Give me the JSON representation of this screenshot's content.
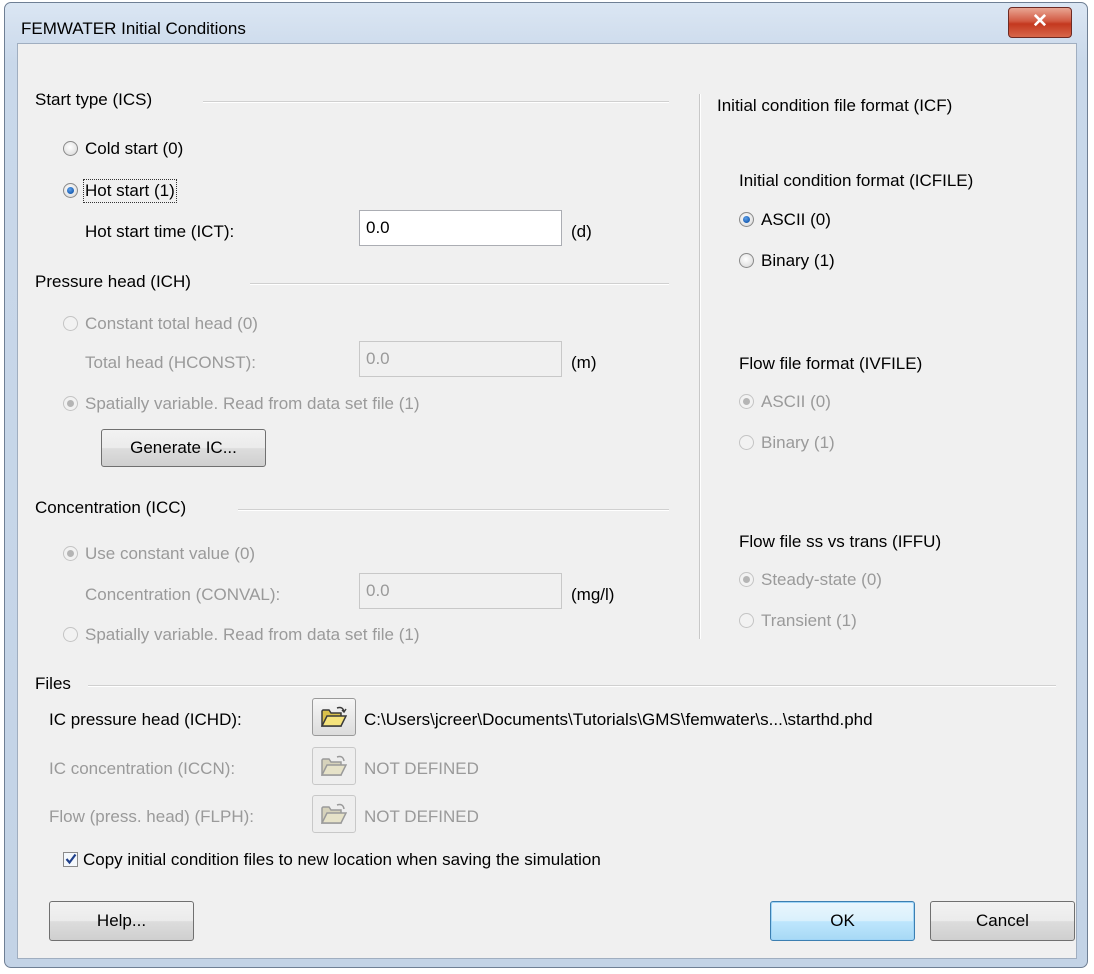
{
  "window": {
    "title": "FEMWATER Initial Conditions",
    "close_glyph": "✕"
  },
  "start_type": {
    "legend": "Start type (ICS)",
    "cold": "Cold start (0)",
    "hot": "Hot start (1)",
    "selected": "hot",
    "time_label": "Hot start time (ICT):",
    "time_value": "0.0",
    "time_unit": "(d)"
  },
  "pressure_head": {
    "legend": "Pressure head (ICH)",
    "constant": "Constant total head (0)",
    "total_label": "Total head (HCONST):",
    "total_value": "0.0",
    "total_unit": "(m)",
    "spatial": "Spatially variable. Read from data set file (1)",
    "selected": "spatial",
    "generate_button": "Generate IC..."
  },
  "concentration": {
    "legend": "Concentration (ICC)",
    "constant": "Use constant value (0)",
    "conc_label": "Concentration (CONVAL):",
    "conc_value": "0.0",
    "conc_unit": "(mg/l)",
    "spatial": "Spatially variable. Read from data set file (1)",
    "selected": "constant"
  },
  "icf": {
    "legend": "Initial condition file format (ICF)",
    "icfile": {
      "label": "Initial condition format (ICFILE)",
      "ascii": "ASCII (0)",
      "binary": "Binary (1)",
      "selected": "ascii"
    },
    "ivfile": {
      "label": "Flow file format (IVFILE)",
      "ascii": "ASCII (0)",
      "binary": "Binary (1)",
      "selected": "ascii"
    },
    "iffu": {
      "label": "Flow file ss vs trans (IFFU)",
      "steady": "Steady-state (0)",
      "transient": "Transient (1)",
      "selected": "steady"
    }
  },
  "files": {
    "legend": "Files",
    "ichd_label": "IC pressure head (ICHD):",
    "ichd_path": "C:\\Users\\jcreer\\Documents\\Tutorials\\GMS\\femwater\\s...\\starthd.phd",
    "iccn_label": "IC concentration (ICCN):",
    "iccn_path": "NOT DEFINED",
    "flph_label": "Flow (press. head) (FLPH):",
    "flph_path": "NOT DEFINED",
    "copy_label": "Copy initial condition files to new location when saving the simulation",
    "copy_checked": true
  },
  "buttons": {
    "help": "Help...",
    "ok": "OK",
    "cancel": "Cancel"
  },
  "icons": {
    "open": "folder-open-icon",
    "close": "close-icon",
    "check": "checkmark-icon"
  },
  "colors": {
    "selected_radio": "#1a5fb4",
    "close_button": "#c4381f",
    "disabled_text": "#9a9a9a"
  }
}
